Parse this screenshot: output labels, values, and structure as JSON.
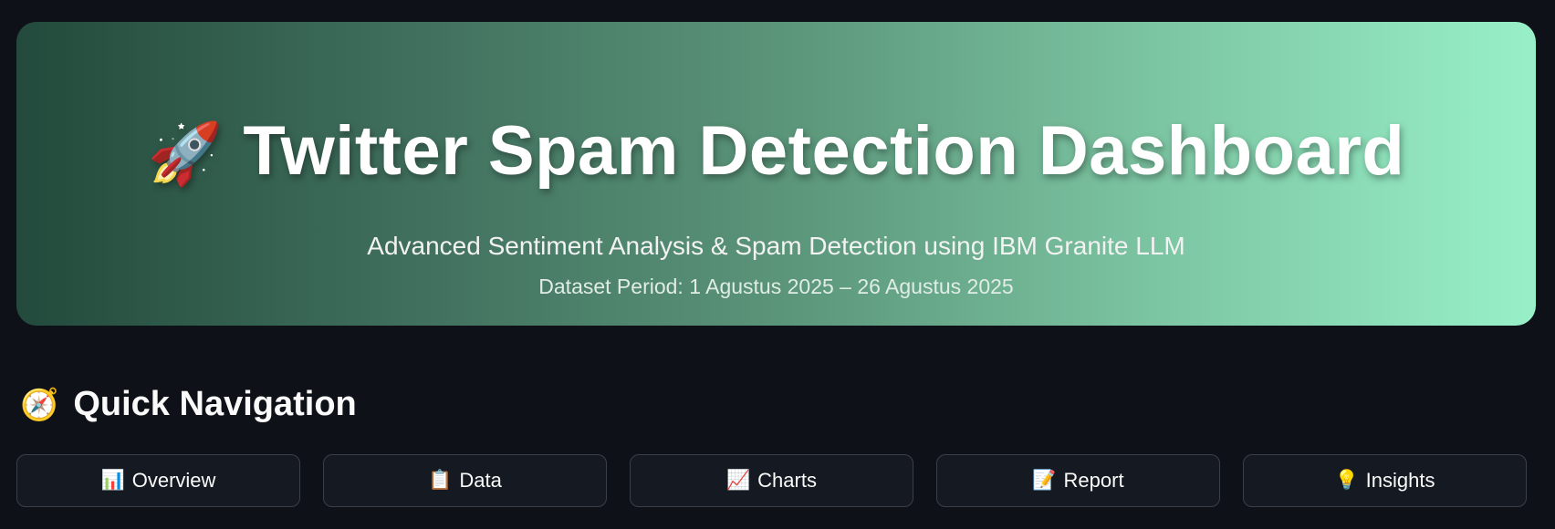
{
  "header": {
    "icon": "rocket-icon",
    "icon_glyph": "🚀",
    "title": "Twitter Spam Detection Dashboard",
    "subtitle": "Advanced Sentiment Analysis & Spam Detection using IBM Granite LLM",
    "period": "Dataset Period: 1 Agustus 2025 – 26 Agustus 2025"
  },
  "navigation": {
    "icon": "compass-icon",
    "icon_glyph": "🧭",
    "heading": "Quick Navigation",
    "buttons": [
      {
        "label": "Overview",
        "icon": "bar-chart-icon",
        "glyph": "📊"
      },
      {
        "label": "Data",
        "icon": "clipboard-icon",
        "glyph": "📋"
      },
      {
        "label": "Charts",
        "icon": "line-chart-icon",
        "glyph": "📈"
      },
      {
        "label": "Report",
        "icon": "memo-icon",
        "glyph": "📝"
      },
      {
        "label": "Insights",
        "icon": "lightbulb-icon",
        "glyph": "💡"
      }
    ]
  }
}
